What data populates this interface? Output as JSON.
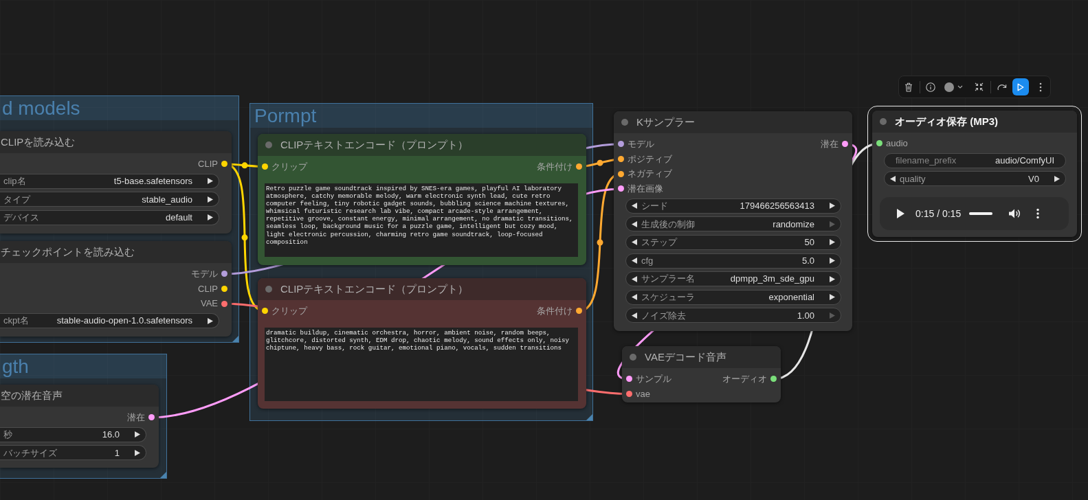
{
  "groups": [
    {
      "title": "d models"
    },
    {
      "title": "gth"
    },
    {
      "title": "Pormpt"
    }
  ],
  "nodes": [
    {
      "title": "CLIPを読み込む",
      "color": "#353535",
      "selected": false,
      "outputs": [
        {
          "label": "CLIP",
          "color": "#ffd500"
        }
      ],
      "widgets": [
        {
          "kind": "combo",
          "label": "clip名",
          "value": "t5-base.safetensors",
          "at_limit": false
        },
        {
          "kind": "combo",
          "label": "タイプ",
          "value": "stable_audio",
          "at_limit": false
        },
        {
          "kind": "combo",
          "label": "デバイス",
          "value": "default",
          "at_limit": false
        }
      ]
    },
    {
      "title": "チェックポイントを読み込む",
      "color": "#353535",
      "selected": false,
      "outputs": [
        {
          "label": "モデル",
          "color": "#b39ddb"
        },
        {
          "label": "CLIP",
          "color": "#ffd500"
        },
        {
          "label": "VAE",
          "color": "#ff6e6e"
        }
      ],
      "widgets": [
        {
          "kind": "combo",
          "label": "ckpt名",
          "value": "stable-audio-open-1.0.safetensors",
          "at_limit": false
        }
      ]
    },
    {
      "title": "空の潜在音声",
      "color": "#353535",
      "selected": false,
      "outputs": [
        {
          "label": "潜在",
          "color": "#ff9cf9"
        }
      ],
      "widgets": [
        {
          "kind": "number",
          "label": "秒",
          "value": "16.0",
          "at_limit": false
        },
        {
          "kind": "number",
          "label": "バッチサイズ",
          "value": "1",
          "at_limit": false
        }
      ]
    },
    {
      "title": "CLIPテキストエンコード（プロンプト）",
      "color": "#335533",
      "selected": false,
      "inputs": [
        {
          "label": "クリップ",
          "color": "#ffd500"
        }
      ],
      "outputs": [
        {
          "label": "条件付け",
          "color": "#ffa931"
        }
      ],
      "text": "Retro puzzle game soundtrack inspired by SNES-era games, playful AI laboratory atmosphere, catchy memorable melody, warm electronic synth lead, cute retro computer feeling, tiny robotic gadget sounds, bubbling science machine textures, whimsical futuristic research lab vibe, compact arcade-style arrangement, repetitive groove, constant energy, minimal arrangement, no dramatic transitions, seamless loop, background music for a puzzle game, intelligent but cozy mood, light electronic percussion, charming retro game soundtrack, loop-focused composition"
    },
    {
      "title": "CLIPテキストエンコード（プロンプト）",
      "color": "#553333",
      "selected": false,
      "inputs": [
        {
          "label": "クリップ",
          "color": "#ffd500"
        }
      ],
      "outputs": [
        {
          "label": "条件付け",
          "color": "#ffa931"
        }
      ],
      "text": "dramatic buildup, cinematic orchestra, horror, ambient noise, random beeps, glitchcore, distorted synth, EDM drop, chaotic melody, sound effects only, noisy chiptune, heavy bass, rock guitar, emotional piano, vocals, sudden transitions"
    },
    {
      "title": "Kサンプラー",
      "color": "#353535",
      "selected": false,
      "inputs": [
        {
          "label": "モデル",
          "color": "#b39ddb"
        },
        {
          "label": "ポジティブ",
          "color": "#ffa931"
        },
        {
          "label": "ネガティブ",
          "color": "#ffa931"
        },
        {
          "label": "潜在画像",
          "color": "#ff9cf9"
        }
      ],
      "outputs": [
        {
          "label": "潜在",
          "color": "#ff9cf9"
        }
      ],
      "widgets": [
        {
          "kind": "number",
          "label": "シード",
          "value": "179466256563413",
          "at_limit": false
        },
        {
          "kind": "combo",
          "label": "生成後の制御",
          "value": "randomize",
          "at_limit": true
        },
        {
          "kind": "number",
          "label": "ステップ",
          "value": "50",
          "at_limit": false
        },
        {
          "kind": "number",
          "label": "cfg",
          "value": "5.0",
          "at_limit": false
        },
        {
          "kind": "combo",
          "label": "サンプラー名",
          "value": "dpmpp_3m_sde_gpu",
          "at_limit": false
        },
        {
          "kind": "combo",
          "label": "スケジューラ",
          "value": "exponential",
          "at_limit": false
        },
        {
          "kind": "number",
          "label": "ノイズ除去",
          "value": "1.00",
          "at_limit": true
        }
      ]
    },
    {
      "title": "VAEデコード音声",
      "color": "#353535",
      "selected": false,
      "inputs": [
        {
          "label": "サンプル",
          "color": "#ff9cf9"
        },
        {
          "label": "vae",
          "color": "#ff6e6e"
        }
      ],
      "outputs": [
        {
          "label": "オーディオ",
          "color": "#7be07b"
        }
      ]
    },
    {
      "title": "オーディオ保存 (MP3)",
      "color": "#353535",
      "selected": true,
      "inputs": [
        {
          "label": "audio",
          "color": "#7be07b"
        }
      ],
      "widgets": [
        {
          "kind": "text",
          "label": "filename_prefix",
          "value": "audio/ComfyUI"
        },
        {
          "kind": "combo",
          "label": "quality",
          "value": "V0",
          "at_limit": false
        }
      ],
      "player": {
        "time": "0:15 / 0:15",
        "level": 1
      }
    }
  ]
}
